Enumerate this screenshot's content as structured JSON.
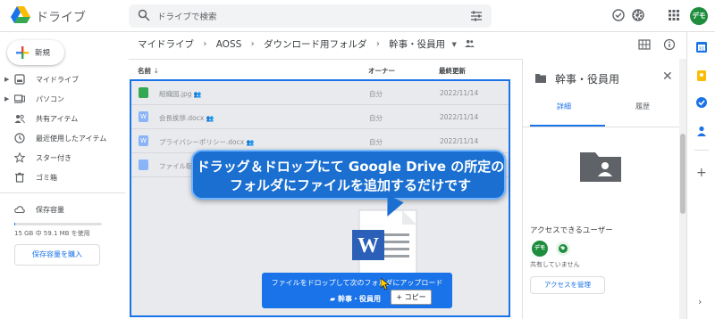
{
  "header": {
    "app_title": "ドライブ",
    "search_placeholder": "ドライブで検索",
    "avatar_text": "デモ"
  },
  "leftnav": {
    "new_label": "新規",
    "items": [
      {
        "label": "マイドライブ",
        "icon": "drive-icon",
        "expandable": true
      },
      {
        "label": "パソコン",
        "icon": "computer-icon",
        "expandable": true
      },
      {
        "label": "共有アイテム",
        "icon": "people-icon",
        "expandable": false
      },
      {
        "label": "最近使用したアイテム",
        "icon": "clock-icon",
        "expandable": false
      },
      {
        "label": "スター付き",
        "icon": "star-icon",
        "expandable": false
      },
      {
        "label": "ゴミ箱",
        "icon": "trash-icon",
        "expandable": false
      }
    ],
    "storage_label": "保存容量",
    "storage_text": "15 GB 中 59.1 MB を使用",
    "storage_fraction": 0.004,
    "buy_storage_label": "保存容量を購入"
  },
  "breadcrumb": {
    "items": [
      "マイドライブ",
      "AOSS",
      "ダウンロード用フォルダ",
      "幹事・役員用"
    ]
  },
  "columns": {
    "name": "名前",
    "owner": "オーナー",
    "modified": "最終更新"
  },
  "files": [
    {
      "name": "組織図.jpg",
      "owner": "自分",
      "date": "2022/11/14",
      "icon": "image-file-icon",
      "color": "#34a853"
    },
    {
      "name": "会長挨拶.docx",
      "owner": "自分",
      "date": "2022/11/14",
      "icon": "word-file-icon",
      "color": "#8ab4f8"
    },
    {
      "name": "プライバシーポリシー.docx",
      "owner": "自分",
      "date": "2022/11/14",
      "icon": "word-file-icon",
      "color": "#8ab4f8"
    },
    {
      "name": "ファイル転",
      "owner": "",
      "date": "",
      "icon": "doc-file-icon",
      "color": "#8ab4f8"
    }
  ],
  "callout": {
    "line1": "ドラッグ＆ドロップにて Google Drive の所定の",
    "line2": "フォルダにファイルを追加するだけです"
  },
  "drop": {
    "text": "ファイルをドロップして次のフォルダにアップロード",
    "folder": "幹事・役員用",
    "copy_label": "+ コピー"
  },
  "details": {
    "title": "幹事・役員用",
    "tab_details": "詳細",
    "tab_activity": "履歴",
    "access_title": "アクセスできるユーザー",
    "owner_avatar": "デモ",
    "shared_note": "共有していません",
    "manage_label": "アクセスを管理"
  },
  "colors": {
    "accent": "#1a73e8",
    "callout": "#1a6fd0"
  }
}
